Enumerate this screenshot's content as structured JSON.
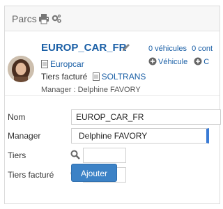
{
  "panel": {
    "title": "Parcs"
  },
  "profile": {
    "name": "EUROP_CAR_FR",
    "company": "Europcar",
    "third_party_label": "Tiers facturé",
    "third_party_value": "SOLTRANS",
    "manager_line": "Manager : Delphine FAVORY"
  },
  "counts": {
    "vehicles": "0 véhicules",
    "contracts": "0 cont"
  },
  "actions": {
    "add_vehicle": "Véhicule",
    "add_other": "C"
  },
  "form": {
    "nom_label": "Nom",
    "nom_value": "EUROP_CAR_FR",
    "manager_label": "Manager",
    "manager_value": "Delphine FAVORY",
    "tiers_label": "Tiers",
    "tiers_value": "",
    "tiers_facture_label": "Tiers facturé",
    "tiers_facture_value": "",
    "submit_label": "Ajouter"
  },
  "colors": {
    "link": "#1a5fa6",
    "button": "#3c82c6",
    "accent_select": "#3a7bd5"
  },
  "icons": [
    "printer-icon",
    "cogs-icon",
    "pencil-icon",
    "document-icon",
    "plus-circle-icon",
    "search-icon"
  ]
}
